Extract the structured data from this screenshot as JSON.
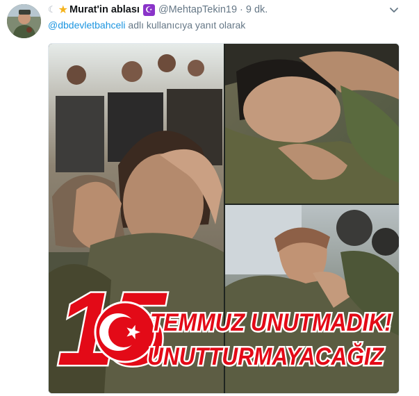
{
  "tweet": {
    "display_name": "Murat'in ablası",
    "handle": "@MehtapTekin19",
    "separator": "·",
    "time": "9 dk.",
    "reply_mention": "@dbdevletbahceli",
    "reply_suffix": "adlı kullanıcıya yanıt olarak",
    "icons": {
      "moon": "crescent-moon-icon",
      "star": "star-icon",
      "badge": "crescent-badge-icon",
      "menu": "chevron-down-icon"
    }
  },
  "media": {
    "banner_number": "15",
    "banner_line1": "TEMMUZ UNUTMADIK!",
    "banner_line2": "UNUTTURMAYACAĞIZ",
    "colors": {
      "banner_red": "#e30a17",
      "link": "#1b95e0",
      "muted": "#657786",
      "badge": "#8a34c9"
    }
  }
}
